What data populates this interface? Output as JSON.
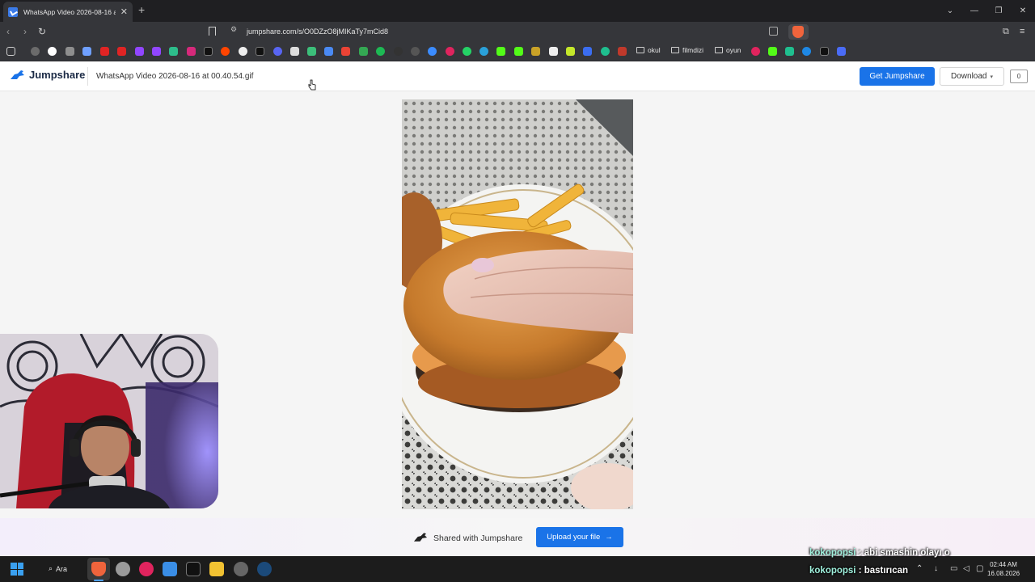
{
  "browser": {
    "tab_title": "WhatsApp Video 2026-08-16 at",
    "tab_close": "✕",
    "new_tab": "+",
    "url": "jumpshare.com/s/O0DZzO8jMIKaTy7mCid8",
    "window_controls": [
      "⌄",
      "—",
      "❐",
      "✕"
    ],
    "bookmark_folders": [
      "okul",
      "filmdizi",
      "oyun"
    ]
  },
  "header": {
    "logo_text": "Jumpshare",
    "file_title": "WhatsApp Video 2026-08-16 at 00.40.54.gif",
    "get_button": "Get Jumpshare",
    "download_button": "Download",
    "download_caret": "▾",
    "comments_count": "0"
  },
  "footer": {
    "shared_text": "Shared with Jumpshare",
    "upload_button": "Upload your file",
    "upload_arrow": "→"
  },
  "chat": {
    "line1_user": "kokopopsi",
    "line1_text": " : abi smashin olayı o",
    "line2_user": "kokopopsi",
    "line2_text": " : bastırıcan"
  },
  "taskbar": {
    "search_label": "Ara",
    "time": "02:44 AM",
    "date": "16.08.2026"
  },
  "colors": {
    "accent": "#1a73e8",
    "browser_dark": "#35363a"
  }
}
